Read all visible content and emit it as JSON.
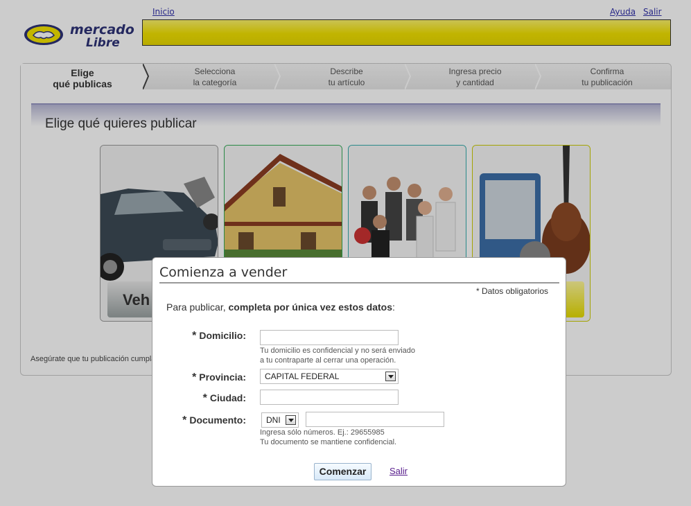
{
  "header": {
    "home_link": "Inicio",
    "help_link": "Ayuda",
    "logout_link": "Salir",
    "logo_line1": "mercado",
    "logo_line2": "Libre",
    "banner_color": "#f2e200"
  },
  "wizard": {
    "steps": [
      {
        "line1": "Elige",
        "line2": "qué publicas",
        "active": true
      },
      {
        "line1": "Selecciona",
        "line2": "la categoría",
        "active": false
      },
      {
        "line1": "Describe",
        "line2": "tu artículo",
        "active": false
      },
      {
        "line1": "Ingresa precio",
        "line2": "y cantidad",
        "active": false
      },
      {
        "line1": "Confirma",
        "line2": "tu publicación",
        "active": false
      }
    ],
    "section_title": "Elige qué quieres publicar",
    "categories": [
      {
        "label": "Veh",
        "icon": "car-motorcycle-image",
        "border": "#999999"
      },
      {
        "label": "",
        "icon": "house-image",
        "border": "#33aa55"
      },
      {
        "label": "",
        "icon": "people-services-image",
        "border": "#33aaaa"
      },
      {
        "label": "",
        "icon": "products-image",
        "border": "#cccc00"
      }
    ],
    "bottom_note": "Asegúrate que tu publicación cumpla"
  },
  "modal": {
    "title": "Comienza a vender",
    "required_note": "* Datos obligatorios",
    "intro_prefix": "Para publicar, ",
    "intro_bold": "completa por única vez estos datos",
    "intro_suffix": ":",
    "address": {
      "label": "Domicilio:",
      "value": "",
      "hint_line1": "Tu domicilio es confidencial y no será enviado",
      "hint_line2": "a tu contraparte al cerrar una operación."
    },
    "province": {
      "label": "Provincia:",
      "selected": "CAPITAL FEDERAL"
    },
    "city": {
      "label": "Ciudad:",
      "value": ""
    },
    "document": {
      "label": "Documento:",
      "type_selected": "DNI",
      "value": "",
      "hint_line1": "Ingresa sólo números. Ej.: 29655985",
      "hint_line2": "Tu documento se mantiene confidencial."
    },
    "star": "*",
    "start_button": "Comenzar",
    "exit_link": "Salir"
  }
}
